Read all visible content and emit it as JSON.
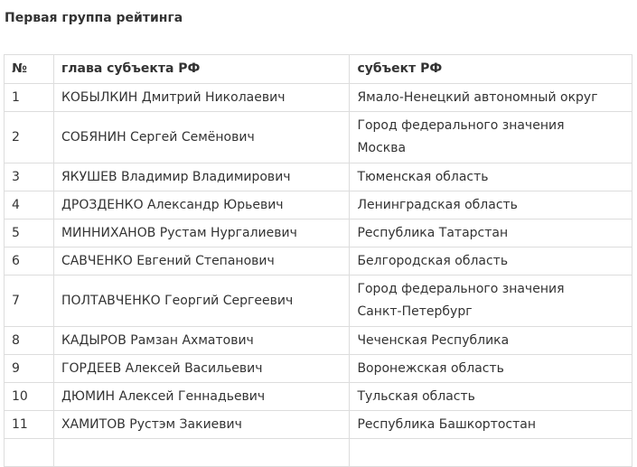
{
  "section": {
    "title": "Первая группа рейтинга"
  },
  "table": {
    "headers": {
      "num": "№",
      "head": "глава субъекта РФ",
      "subject": "субъект РФ"
    },
    "rows": [
      {
        "num": "1",
        "head": "КОБЫЛКИН Дмитрий Николаевич",
        "subject_line1": "Ямало-Ненецкий автономный округ",
        "subject_line2": ""
      },
      {
        "num": "2",
        "head": "СОБЯНИН Сергей Семёнович",
        "subject_line1": "Город федерального значения",
        "subject_line2": "Москва"
      },
      {
        "num": "3",
        "head": "ЯКУШЕВ Владимир Владимирович",
        "subject_line1": "Тюменская область",
        "subject_line2": ""
      },
      {
        "num": "4",
        "head": "ДРОЗДЕНКО Александр Юрьевич",
        "subject_line1": "Ленинградская область",
        "subject_line2": ""
      },
      {
        "num": "5",
        "head": "МИННИХАНОВ Рустам Нургалиевич",
        "subject_line1": "Республика Татарстан",
        "subject_line2": ""
      },
      {
        "num": "6",
        "head": "САВЧЕНКО Евгений Степанович",
        "subject_line1": "Белгородская область",
        "subject_line2": ""
      },
      {
        "num": "7",
        "head": "ПОЛТАВЧЕНКО Георгий Сергеевич",
        "subject_line1": "Город федерального значения",
        "subject_line2": "Санкт-Петербург"
      },
      {
        "num": "8",
        "head": "КАДЫРОВ Рамзан Ахматович",
        "subject_line1": "Чеченская Республика",
        "subject_line2": ""
      },
      {
        "num": "9",
        "head": "ГОРДЕЕВ Алексей Васильевич",
        "subject_line1": "Воронежская область",
        "subject_line2": ""
      },
      {
        "num": "10",
        "head": "ДЮМИН Алексей Геннадьевич",
        "subject_line1": "Тульская область",
        "subject_line2": ""
      },
      {
        "num": "11",
        "head": "ХАМИТОВ Рустэм Закиевич",
        "subject_line1": "Республика Башкортостан",
        "subject_line2": ""
      }
    ]
  }
}
